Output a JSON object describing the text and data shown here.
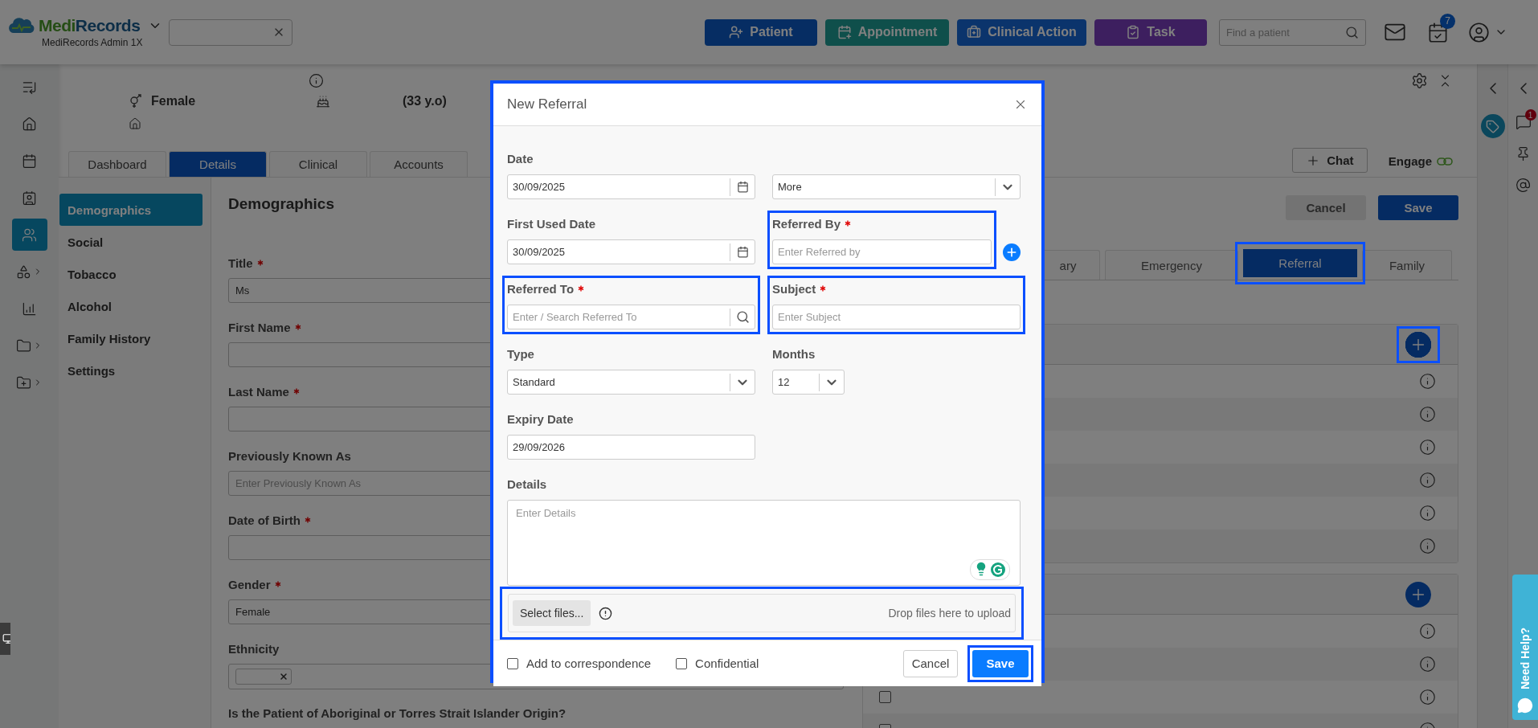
{
  "header": {
    "brand": [
      "Medi",
      "Records"
    ],
    "account": "MediRecords Admin 1X",
    "actions": [
      {
        "label": "Patient",
        "kind": "patient"
      },
      {
        "label": "Appointment",
        "kind": "appointment"
      },
      {
        "label": "Clinical Action",
        "kind": "clinical"
      },
      {
        "label": "Task",
        "kind": "task"
      }
    ],
    "find": {
      "placeholder": "Find a patient"
    },
    "task_count": "7"
  },
  "rail": [
    {
      "kind": "expand",
      "selected": false,
      "submenu": false
    },
    {
      "kind": "home",
      "selected": false,
      "submenu": false
    },
    {
      "kind": "calendar",
      "selected": false,
      "submenu": false
    },
    {
      "kind": "contacts",
      "selected": false,
      "submenu": false
    },
    {
      "kind": "patients",
      "selected": true,
      "submenu": false
    },
    {
      "kind": "apps",
      "selected": false,
      "submenu": true
    },
    {
      "kind": "reports",
      "selected": false,
      "submenu": false
    },
    {
      "kind": "folder",
      "selected": false,
      "submenu": true
    },
    {
      "kind": "new-folder",
      "selected": false,
      "submenu": true
    }
  ],
  "patient": {
    "gender": "Female",
    "age": "(33 y.o)"
  },
  "main_tabs": [
    {
      "label": "Dashboard",
      "selected": false
    },
    {
      "label": "Details",
      "selected": true
    },
    {
      "label": "Clinical",
      "selected": false
    },
    {
      "label": "Accounts",
      "selected": false
    }
  ],
  "chat_button": "Chat",
  "engage": "Engage",
  "side_menu": [
    {
      "label": "Demographics",
      "selected": true
    },
    {
      "label": "Social",
      "selected": false
    },
    {
      "label": "Tobacco",
      "selected": false
    },
    {
      "label": "Alcohol",
      "selected": false
    },
    {
      "label": "Family History",
      "selected": false
    },
    {
      "label": "Settings",
      "selected": false
    }
  ],
  "form": {
    "heading": "Demographics",
    "fields": [
      {
        "label": "Title",
        "required": true,
        "kind": "text",
        "value": "Ms"
      },
      {
        "label": "First Name",
        "required": true,
        "kind": "text"
      },
      {
        "label": "Last Name",
        "required": true,
        "kind": "text"
      },
      {
        "label": "Previously Known As",
        "required": false,
        "kind": "text",
        "placeholder": "Enter Previously Known As"
      },
      {
        "label": "Date of Birth",
        "required": true,
        "kind": "text"
      },
      {
        "label": "Gender",
        "required": true,
        "kind": "text",
        "value": "Female"
      },
      {
        "label": "Ethnicity",
        "required": false,
        "kind": "tags"
      },
      {
        "label": "Is the Patient of Aboriginal or Torres Strait Islander Origin?",
        "required": false,
        "kind": "question"
      }
    ]
  },
  "right": {
    "buttons": [
      {
        "label": "Cancel",
        "kind": "secondary"
      },
      {
        "label": "Save",
        "kind": "primary"
      }
    ],
    "tabs": [
      {
        "label": "ary",
        "selected": false,
        "highlighted": false
      },
      {
        "label": "Emergency",
        "selected": false,
        "highlighted": false
      },
      {
        "label": "Referral",
        "selected": true,
        "highlighted": true
      },
      {
        "label": "Family",
        "selected": false,
        "highlighted": false
      }
    ],
    "panels": [
      {
        "add_highlighted": true,
        "rows": [
          {
            "kind": "plain"
          },
          {
            "kind": "plain"
          },
          {
            "kind": "plain"
          },
          {
            "kind": "plain"
          },
          {
            "kind": "plain"
          },
          {
            "kind": "plain"
          }
        ]
      },
      {
        "add_highlighted": false,
        "rows": [
          {
            "kind": "checkbox"
          },
          {
            "kind": "checkbox"
          },
          {
            "kind": "checkbox",
            "checked": false
          },
          {
            "kind": "checkbox",
            "checked": false
          }
        ]
      }
    ]
  },
  "dock": {
    "chat_count": "1"
  },
  "help": "Need Help?",
  "modal": {
    "title": "New Referral",
    "highlighted": true,
    "fields": [
      {
        "label": "Date",
        "kind": "date",
        "value": "30/09/2025",
        "required": false,
        "highlighted": false
      },
      {
        "kind": "select",
        "value": "More",
        "required": false,
        "highlighted": false
      },
      {
        "label": "First Used Date",
        "kind": "date",
        "value": "30/09/2025",
        "required": false,
        "highlighted": false
      },
      {
        "label": "Referred By",
        "kind": "text",
        "placeholder": "Enter Referred by",
        "required": true,
        "highlighted": true,
        "add_button": true
      },
      {
        "label": "Referred To",
        "kind": "search",
        "placeholder": "Enter / Search Referred To",
        "required": true,
        "highlighted": true
      },
      {
        "label": "Subject",
        "kind": "text",
        "placeholder": "Enter Subject",
        "required": true,
        "highlighted": true
      },
      {
        "label": "Type",
        "kind": "select",
        "value": "Standard",
        "required": false,
        "highlighted": false
      },
      {
        "label": "Months",
        "kind": "short_select",
        "value": "12",
        "required": false,
        "highlighted": false
      },
      {
        "label": "Expiry Date",
        "kind": "text",
        "value": "29/09/2026",
        "required": false,
        "highlighted": false
      },
      {
        "label": "Details",
        "kind": "textarea",
        "placeholder": "Enter Details",
        "required": false,
        "highlighted": false
      }
    ],
    "upload": {
      "button": "Select files...",
      "hint": "Drop files here to upload",
      "highlighted": true
    },
    "options": [
      {
        "label": "Add to correspondence",
        "checked": false
      },
      {
        "label": "Confidential",
        "checked": false
      }
    ],
    "buttons": [
      {
        "label": "Cancel",
        "kind": "secondary",
        "highlighted": false
      },
      {
        "label": "Save",
        "kind": "primary",
        "highlighted": true
      }
    ]
  }
}
